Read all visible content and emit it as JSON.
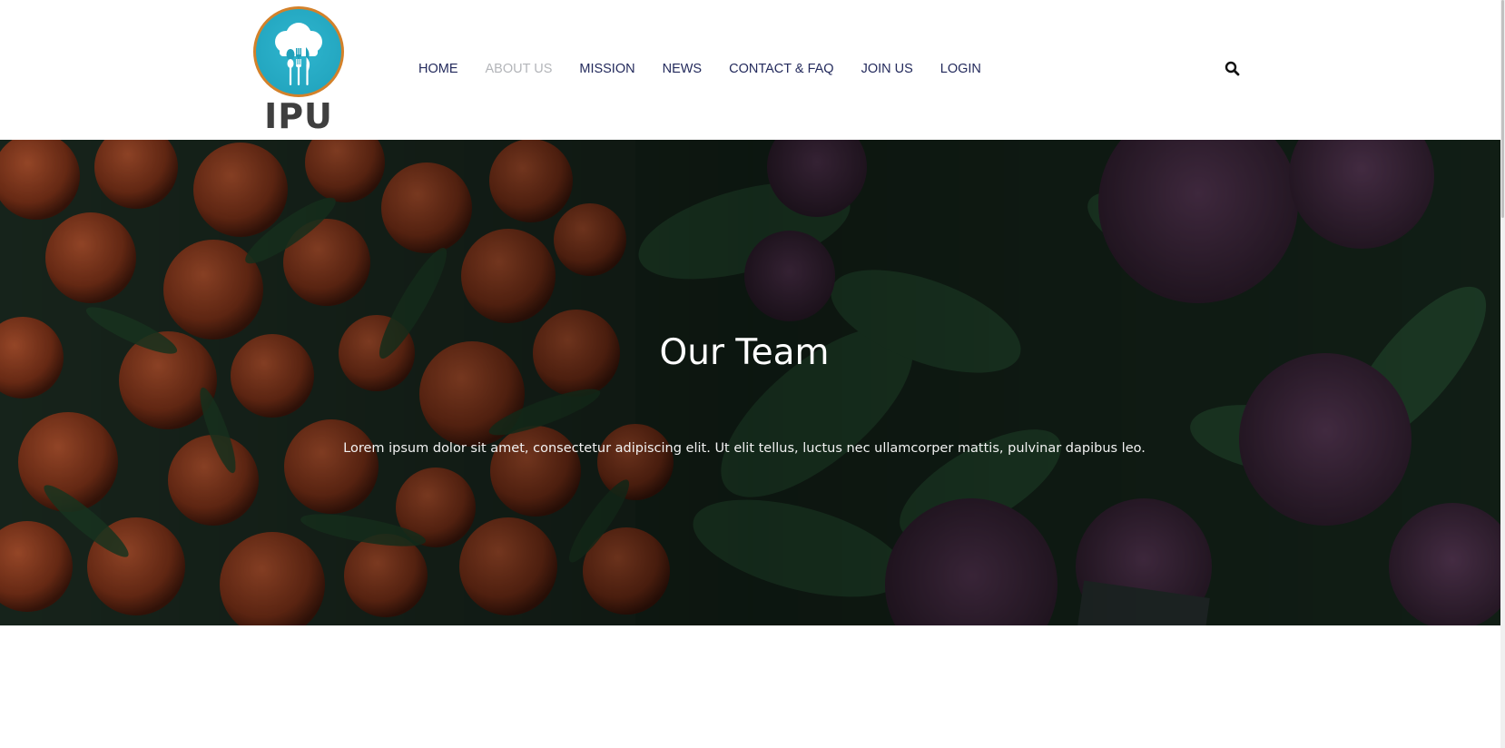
{
  "brand": {
    "logo_text": "IPU",
    "logo_icon": "chef-hat-utensils-icon",
    "ring_color": "#d3812a",
    "circle_color": "#1fa0ba"
  },
  "nav": {
    "items": [
      {
        "label": "HOME",
        "active": false
      },
      {
        "label": "ABOUT US",
        "active": true
      },
      {
        "label": "MISSION",
        "active": false
      },
      {
        "label": "NEWS",
        "active": false
      },
      {
        "label": "CONTACT & FAQ",
        "active": false
      },
      {
        "label": "JOIN US",
        "active": false
      },
      {
        "label": "LOGIN",
        "active": false
      }
    ],
    "search_icon": "search-icon",
    "text_color": "#232a5c",
    "active_color": "#b3b5b9"
  },
  "hero": {
    "title": "Our Team",
    "text": "Lorem ipsum dolor sit amet, consectetur adipiscing elit. Ut elit tellus, luctus nec ullamcorper mattis, pulvinar dapibus leo.",
    "background": "dark-overlay-oranges-and-purple-cauliflower-photo"
  }
}
